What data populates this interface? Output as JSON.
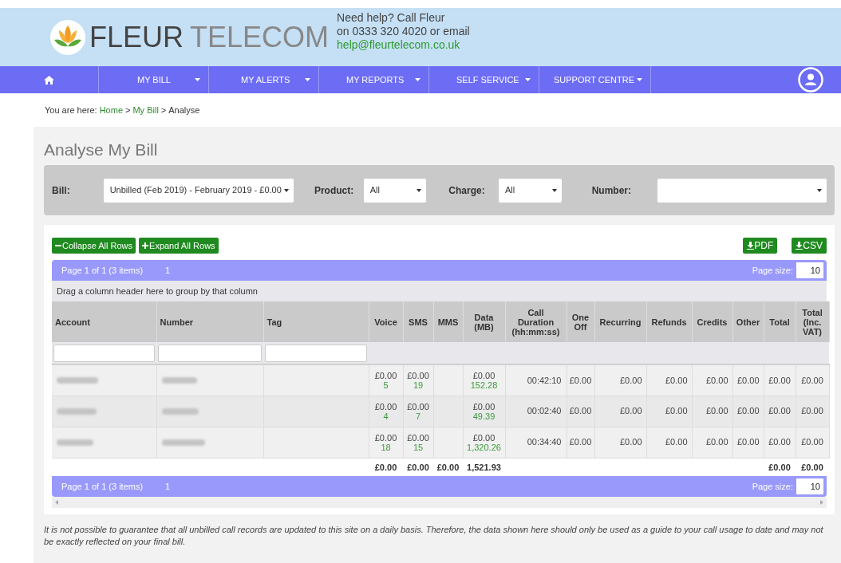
{
  "header": {
    "logo": {
      "word_1": "FLEUR",
      "word_2": "TELECOM"
    },
    "help_lines": [
      "Need help? Call Fleur",
      "on 0333 320 4020 or email"
    ],
    "help_email": "help@fleurtelecom.co.uk"
  },
  "nav": {
    "items": [
      {
        "label": "MY BILL"
      },
      {
        "label": "MY ALERTS"
      },
      {
        "label": "MY REPORTS"
      },
      {
        "label": "SELF SERVICE"
      },
      {
        "label": "SUPPORT CENTRE"
      }
    ]
  },
  "breadcrumb": {
    "prefix": "You are here:",
    "links": [
      "Home",
      "My Bill"
    ],
    "current": "Analyse",
    "separator": ">"
  },
  "page_title": "Analyse My Bill",
  "filters": [
    {
      "label": "Bill:",
      "value": "Unbilled (Feb 2019) - February 2019 - £0.00"
    },
    {
      "label": "Product:",
      "value": "All"
    },
    {
      "label": "Charge:",
      "value": "All"
    },
    {
      "label": "Number:"
    }
  ],
  "toolbar": {
    "left": [
      "Collapse All Rows",
      "Expand All Rows"
    ],
    "right": [
      "PDF",
      "CSV"
    ]
  },
  "pagers": [
    {
      "summary": "Page 1 of 1 (3 items)",
      "page": "1",
      "page_size_label": "Page size:",
      "page_size": "10"
    },
    {
      "summary": "Page 1 of 1 (3 items)",
      "page": "1",
      "page_size_label": "Page size:",
      "page_size": "10"
    }
  ],
  "group_hint": "Drag a column header here to group by that column",
  "table": {
    "columns": [
      "Account",
      "Number",
      "Tag",
      "Voice",
      "SMS",
      "MMS",
      "Data (MB)",
      "Call Duration (hh:mm:ss)",
      "One Off",
      "Recurring",
      "Refunds",
      "Credits",
      "Other",
      "Total",
      "Total (Inc. VAT)"
    ],
    "rows": [
      {
        "voice": [
          "£0.00",
          "5"
        ],
        "sms": [
          "£0.00",
          "19"
        ],
        "data": [
          "£0.00",
          "152.28"
        ],
        "duration": "00:42:10",
        "charges": [
          "£0.00",
          "£0.00",
          "£0.00",
          "£0.00",
          "£0.00",
          "£0.00",
          "£0.00"
        ]
      },
      {
        "voice": [
          "£0.00",
          "4"
        ],
        "sms": [
          "£0.00",
          "7"
        ],
        "data": [
          "£0.00",
          "49.39"
        ],
        "duration": "00:02:40",
        "charges": [
          "£0.00",
          "£0.00",
          "£0.00",
          "£0.00",
          "£0.00",
          "£0.00",
          "£0.00"
        ]
      },
      {
        "voice": [
          "£0.00",
          "18"
        ],
        "sms": [
          "£0.00",
          "15"
        ],
        "data": [
          "£0.00",
          "1,320.26"
        ],
        "duration": "00:34:40",
        "charges": [
          "£0.00",
          "£0.00",
          "£0.00",
          "£0.00",
          "£0.00",
          "£0.00",
          "£0.00"
        ]
      }
    ],
    "totals": {
      "voice": "£0.00",
      "sms": "£0.00",
      "mms": "£0.00",
      "data": "1,521.93",
      "total": "£0.00",
      "total_vat": "£0.00"
    }
  },
  "note": "It is not possible to guarantee that all unbilled call records are updated to this site on a daily basis. Therefore, the data shown here should only be used as a guide to your call usage to date and may not be exactly reflected on your final bill."
}
